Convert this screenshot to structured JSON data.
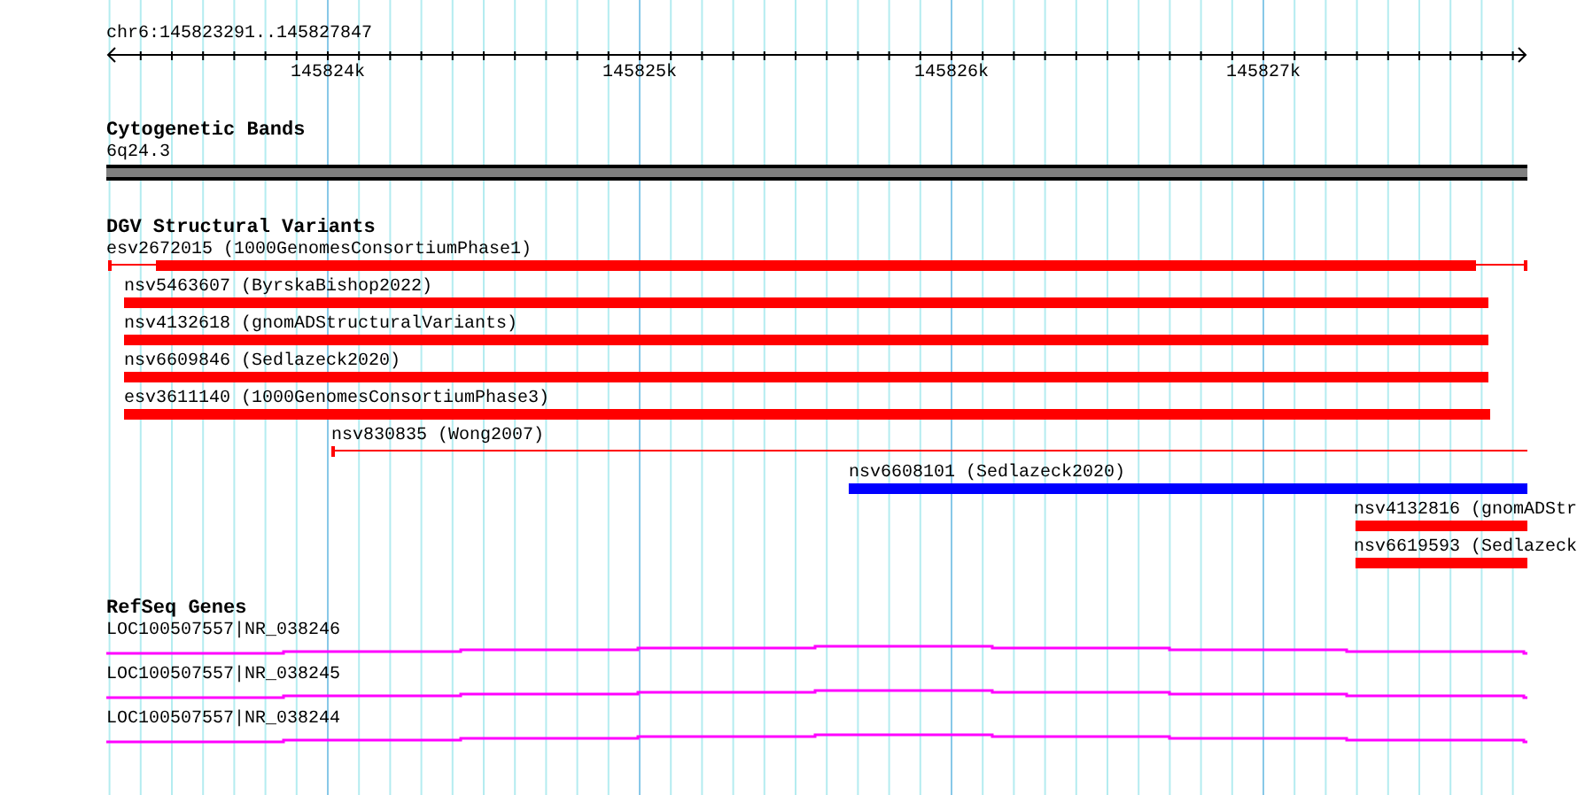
{
  "ruler": {
    "range_label": "chr6:145823291..145827847",
    "ticks": [
      "145824k",
      "145825k",
      "145826k",
      "145827k"
    ]
  },
  "tracks": [
    {
      "kind": "bands",
      "title": "Cytogenetic Bands",
      "features": [
        {
          "label": "6q24.3"
        }
      ]
    },
    {
      "kind": "variants",
      "title": "DGV Structural Variants",
      "features": [
        {
          "label": "esv2672015 (1000GenomesConsortiumPhase1)",
          "color": "#ff0000"
        },
        {
          "label": "nsv5463607 (ByrskaBishop2022)",
          "color": "#ff0000"
        },
        {
          "label": "nsv4132618 (gnomADStructuralVariants)",
          "color": "#ff0000"
        },
        {
          "label": "nsv6609846 (Sedlazeck2020)",
          "color": "#ff0000"
        },
        {
          "label": "esv3611140 (1000GenomesConsortiumPhase3)",
          "color": "#ff0000"
        },
        {
          "label": "nsv830835 (Wong2007)",
          "color": "#ff0000"
        },
        {
          "label": "nsv6608101 (Sedlazeck2020)",
          "color": "#0000ff"
        },
        {
          "label": "nsv4132816 (gnomADStr",
          "color": "#ff0000"
        },
        {
          "label": "nsv6619593 (Sedlazeck",
          "color": "#ff0000"
        }
      ]
    },
    {
      "kind": "genes",
      "title": "RefSeq Genes",
      "features": [
        {
          "label": "LOC100507557|NR_038246"
        },
        {
          "label": "LOC100507557|NR_038245"
        },
        {
          "label": "LOC100507557|NR_038244"
        }
      ]
    }
  ]
}
